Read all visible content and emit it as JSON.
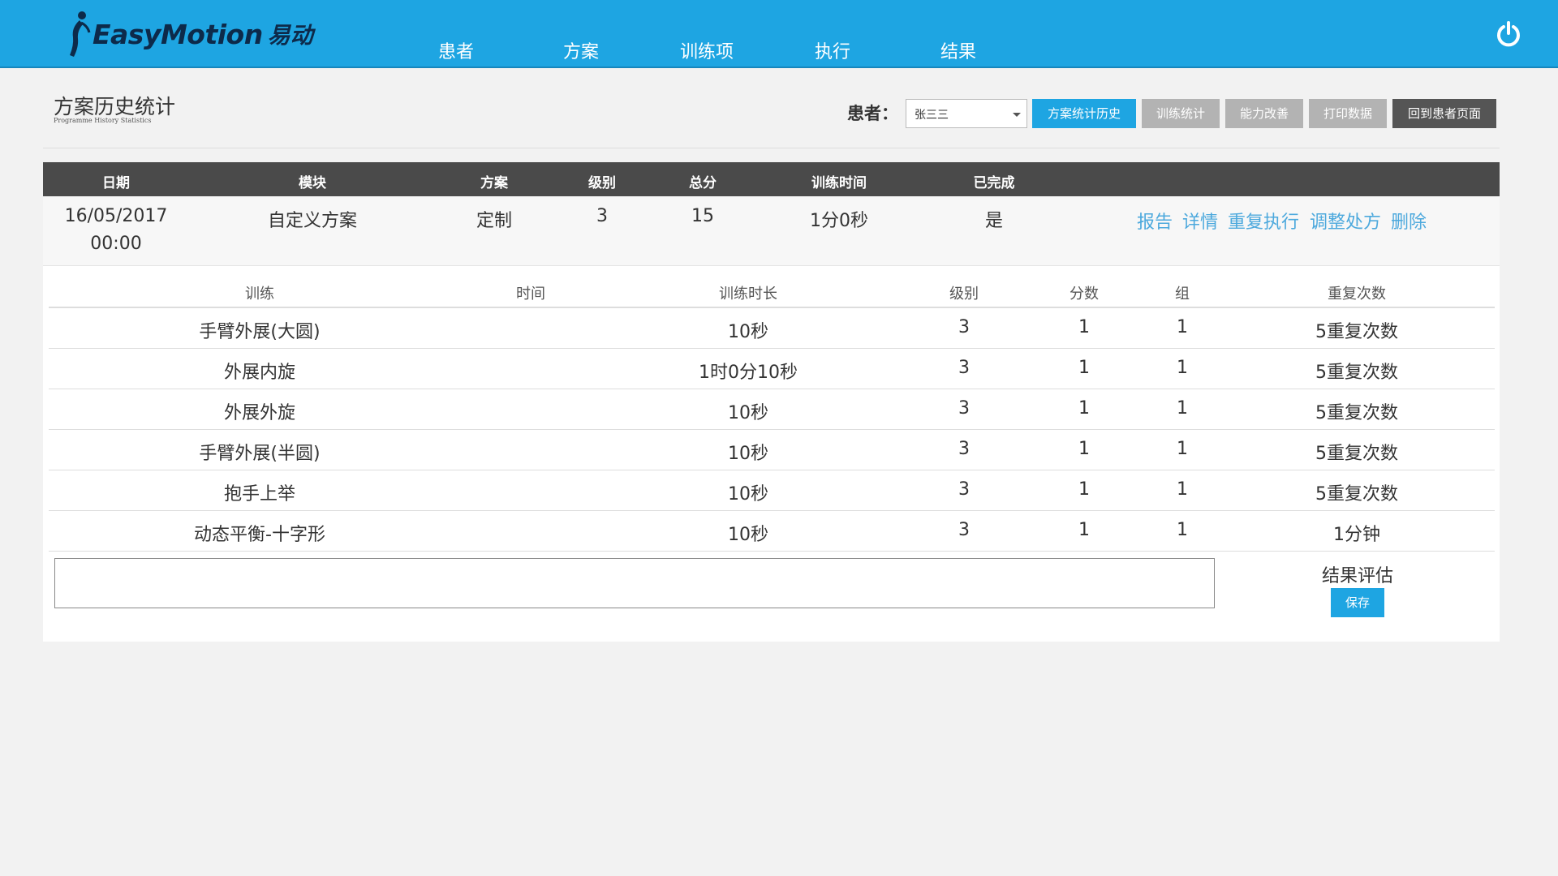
{
  "header": {
    "logo_text": "EasyMotion",
    "logo_cn": "易动",
    "nav": [
      {
        "label": "患者"
      },
      {
        "label": "方案"
      },
      {
        "label": "训练项"
      },
      {
        "label": "执行"
      },
      {
        "label": "结果"
      }
    ],
    "power_icon": "power-icon"
  },
  "page": {
    "title": "方案历史统计",
    "subtitle": "Programme History Statistics"
  },
  "toolbar": {
    "patient_label": "患者：",
    "patient_value": "张三三",
    "buttons": [
      {
        "label": "方案统计历史",
        "style": "blue"
      },
      {
        "label": "训练统计",
        "style": "gray"
      },
      {
        "label": "能力改善",
        "style": "gray"
      },
      {
        "label": "打印数据",
        "style": "gray"
      },
      {
        "label": "回到患者页面",
        "style": "dark"
      }
    ]
  },
  "main_table": {
    "headers": [
      "日期",
      "模块",
      "方案",
      "级别",
      "总分",
      "训练时间",
      "已完成"
    ],
    "row": {
      "date": "16/05/2017",
      "time": "00:00",
      "module": "自定义方案",
      "plan": "定制",
      "level": "3",
      "score": "15",
      "duration": "1分0秒",
      "completed": "是",
      "actions": [
        "报告",
        "详情",
        "重复执行",
        "调整处方",
        "删除"
      ]
    }
  },
  "sub_table": {
    "headers": [
      "训练",
      "时间",
      "训练时长",
      "级别",
      "分数",
      "组",
      "重复次数"
    ],
    "rows": [
      {
        "training": "手臂外展(大圆)",
        "time": "",
        "duration": "10秒",
        "level": "3",
        "score": "1",
        "group": "1",
        "reps": "5重复次数"
      },
      {
        "training": "外展内旋",
        "time": "",
        "duration": "1时0分10秒",
        "level": "3",
        "score": "1",
        "group": "1",
        "reps": "5重复次数"
      },
      {
        "training": "外展外旋",
        "time": "",
        "duration": "10秒",
        "level": "3",
        "score": "1",
        "group": "1",
        "reps": "5重复次数"
      },
      {
        "training": "手臂外展(半圆)",
        "time": "",
        "duration": "10秒",
        "level": "3",
        "score": "1",
        "group": "1",
        "reps": "5重复次数"
      },
      {
        "training": "抱手上举",
        "time": "",
        "duration": "10秒",
        "level": "3",
        "score": "1",
        "group": "1",
        "reps": "5重复次数"
      },
      {
        "training": "动态平衡-十字形",
        "time": "",
        "duration": "10秒",
        "level": "3",
        "score": "1",
        "group": "1",
        "reps": "1分钟"
      }
    ]
  },
  "evaluation": {
    "value": "",
    "label": "结果评估",
    "save_label": "保存"
  },
  "colors": {
    "brand": "#1ea5e2",
    "header_dark": "#4a4a4a",
    "action_link": "#4da9dd",
    "button_gray": "#b3b3b3",
    "button_dark": "#555555"
  }
}
